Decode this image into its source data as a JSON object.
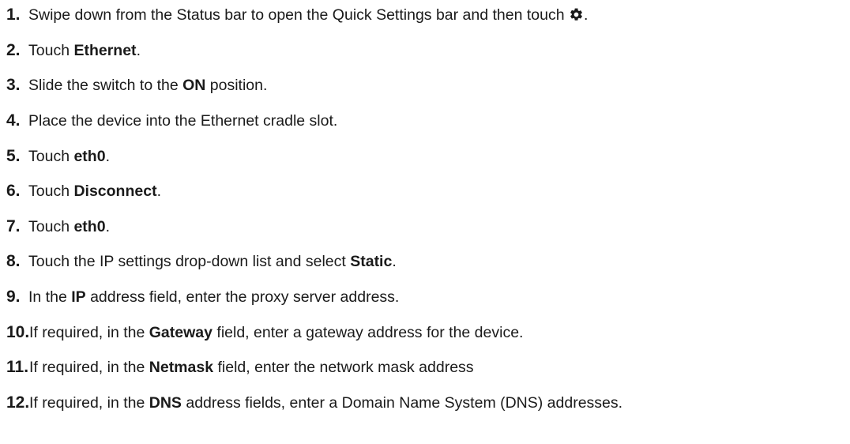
{
  "steps": [
    {
      "num": "1.",
      "parts": [
        "Swipe down from the Status bar to open the Quick Settings bar and then touch ",
        "",
        "."
      ],
      "icon": "gear-icon"
    },
    {
      "num": "2.",
      "parts": [
        "Touch ",
        "Ethernet",
        "."
      ]
    },
    {
      "num": "3.",
      "parts": [
        "Slide the switch to the ",
        "ON",
        " position."
      ]
    },
    {
      "num": "4.",
      "parts": [
        "Place the device into the Ethernet cradle slot."
      ]
    },
    {
      "num": "5.",
      "parts": [
        "Touch ",
        "eth0",
        "."
      ]
    },
    {
      "num": "6.",
      "parts": [
        "Touch ",
        "Disconnect",
        "."
      ]
    },
    {
      "num": "7.",
      "parts": [
        "Touch ",
        "eth0",
        "."
      ]
    },
    {
      "num": "8.",
      "parts": [
        "Touch the IP settings drop-down list and select ",
        "Static",
        "."
      ]
    },
    {
      "num": "9.",
      "parts": [
        "In the ",
        "IP",
        " address field, enter the proxy server address."
      ]
    },
    {
      "num": "10.",
      "parts": [
        "If required, in the ",
        "Gateway",
        " field, enter a gateway address for the device."
      ]
    },
    {
      "num": "11.",
      "parts": [
        "If required, in the ",
        "Netmask",
        " field, enter the network mask address"
      ]
    },
    {
      "num": "12.",
      "parts": [
        "If required, in the ",
        "DNS",
        " address fields, enter a Domain Name System (DNS) addresses."
      ]
    }
  ]
}
